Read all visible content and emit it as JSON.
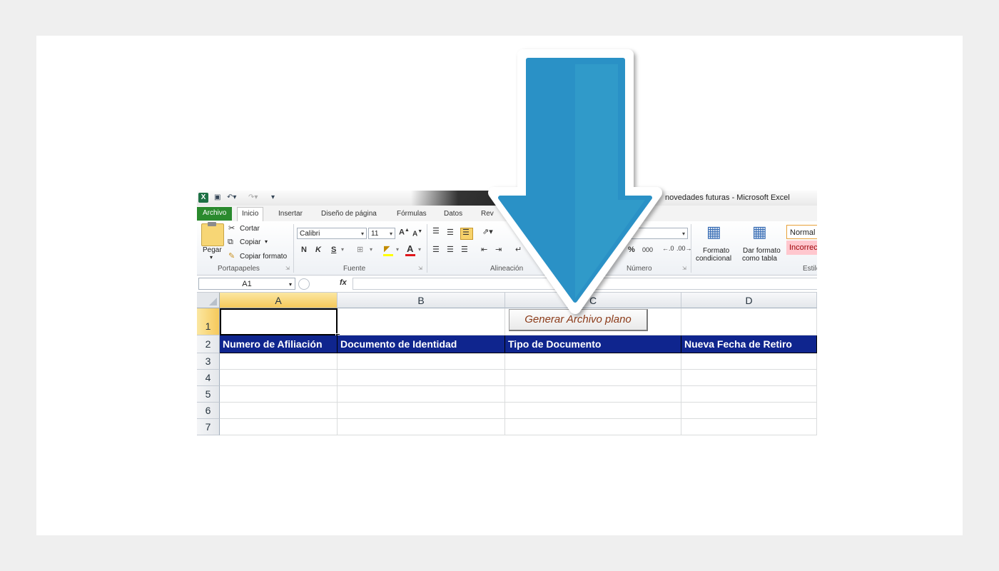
{
  "window": {
    "title": "novedades futuras  -  Microsoft Excel",
    "app_icon": "X"
  },
  "tabs": [
    {
      "label": "Archivo"
    },
    {
      "label": "Inicio"
    },
    {
      "label": "Insertar"
    },
    {
      "label": "Diseño de página"
    },
    {
      "label": "Fórmulas"
    },
    {
      "label": "Datos"
    },
    {
      "label": "Rev"
    }
  ],
  "ribbon": {
    "clipboard": {
      "paste": "Pegar",
      "cut": "Cortar",
      "copy": "Copiar",
      "format_painter": "Copiar formato",
      "group": "Portapapeles"
    },
    "font": {
      "name": "Calibri",
      "size": "11",
      "bold": "N",
      "italic": "K",
      "underline": "S",
      "group": "Fuente"
    },
    "alignment": {
      "group": "Alineación"
    },
    "number": {
      "percent": "%",
      "thousands": "000",
      "group": "Número"
    },
    "styles": {
      "conditional_1": "Formato",
      "conditional_2": "condicional",
      "table_1": "Dar formato",
      "table_2": "como tabla",
      "normal": "Normal",
      "bad": "Incorrecto",
      "group": "Estilos"
    }
  },
  "formula_bar": {
    "name_box": "A1",
    "fx": "fx",
    "formula": ""
  },
  "sheet": {
    "columns": [
      "A",
      "B",
      "C",
      "D"
    ],
    "rows": [
      "1",
      "2",
      "3",
      "4",
      "5",
      "6",
      "7"
    ],
    "headers": [
      "Numero de Afiliación",
      "Documento de Identidad",
      "Tipo de Documento",
      "Nueva Fecha de Retiro"
    ],
    "button": "Generar Archivo plano"
  },
  "colors": {
    "header_fill": "#0f258e",
    "arrow": "#2a91c6",
    "file_tab": "#2a8a2e"
  }
}
